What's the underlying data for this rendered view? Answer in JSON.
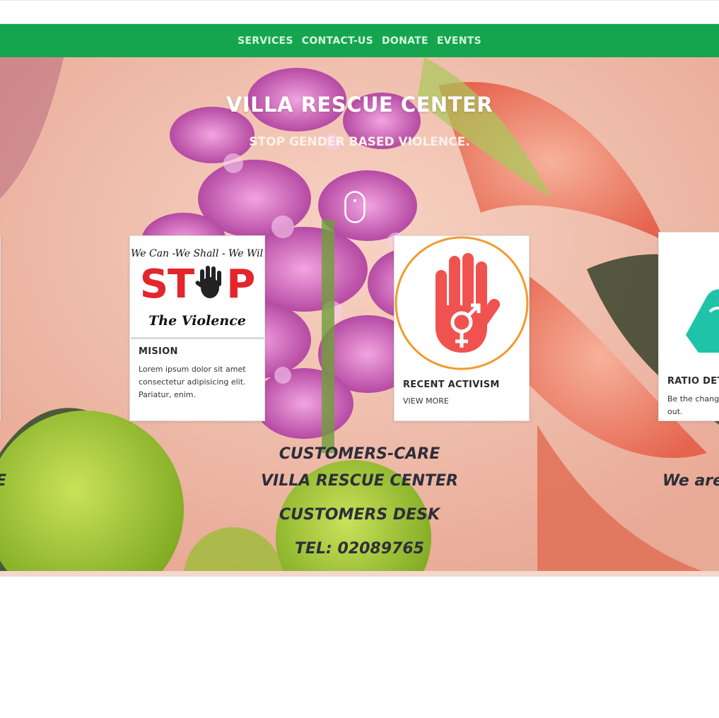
{
  "nav": {
    "items": [
      {
        "label": "SERVICES"
      },
      {
        "label": "CONTACT-US"
      },
      {
        "label": "DONATE"
      },
      {
        "label": "EVENTS"
      }
    ]
  },
  "hero": {
    "title": "VILLA RESCUE CENTER",
    "subtitle": "STOP GENDER BASED VIOLENCE.",
    "scroll_icon": "mouse-scroll-icon"
  },
  "cards": [
    {
      "title": "MISION",
      "text": "Lorem ipsum dolor sit amet consectetur adipisicing elit. Pariatur, enim.",
      "image": {
        "line1": "We Can -We Shall - We Will",
        "big_left": "ST",
        "big_right": "P",
        "line3": "The Violence"
      }
    },
    {
      "title": "RECENT ACTIVISM",
      "link": "VIEW MORE",
      "image": "gender-equality-hand-icon"
    },
    {
      "title": "RATIO DET",
      "text": "Be the change",
      "text2": "out.",
      "image": "teal-hand-icon"
    }
  ],
  "footer": {
    "line1": "CUSTOMERS-CARE",
    "line2": "VILLA RESCUE CENTER",
    "line3": "CUSTOMERS DESK",
    "line4": "TEL: 02089765",
    "left_fragment": "E",
    "right_fragment": "We are"
  },
  "colors": {
    "nav_bg": "#14a54e",
    "nav_text": "#d9f5df",
    "icon_red": "#f0524f",
    "icon_ring": "#f39a2b",
    "teal": "#1fc4a8"
  }
}
